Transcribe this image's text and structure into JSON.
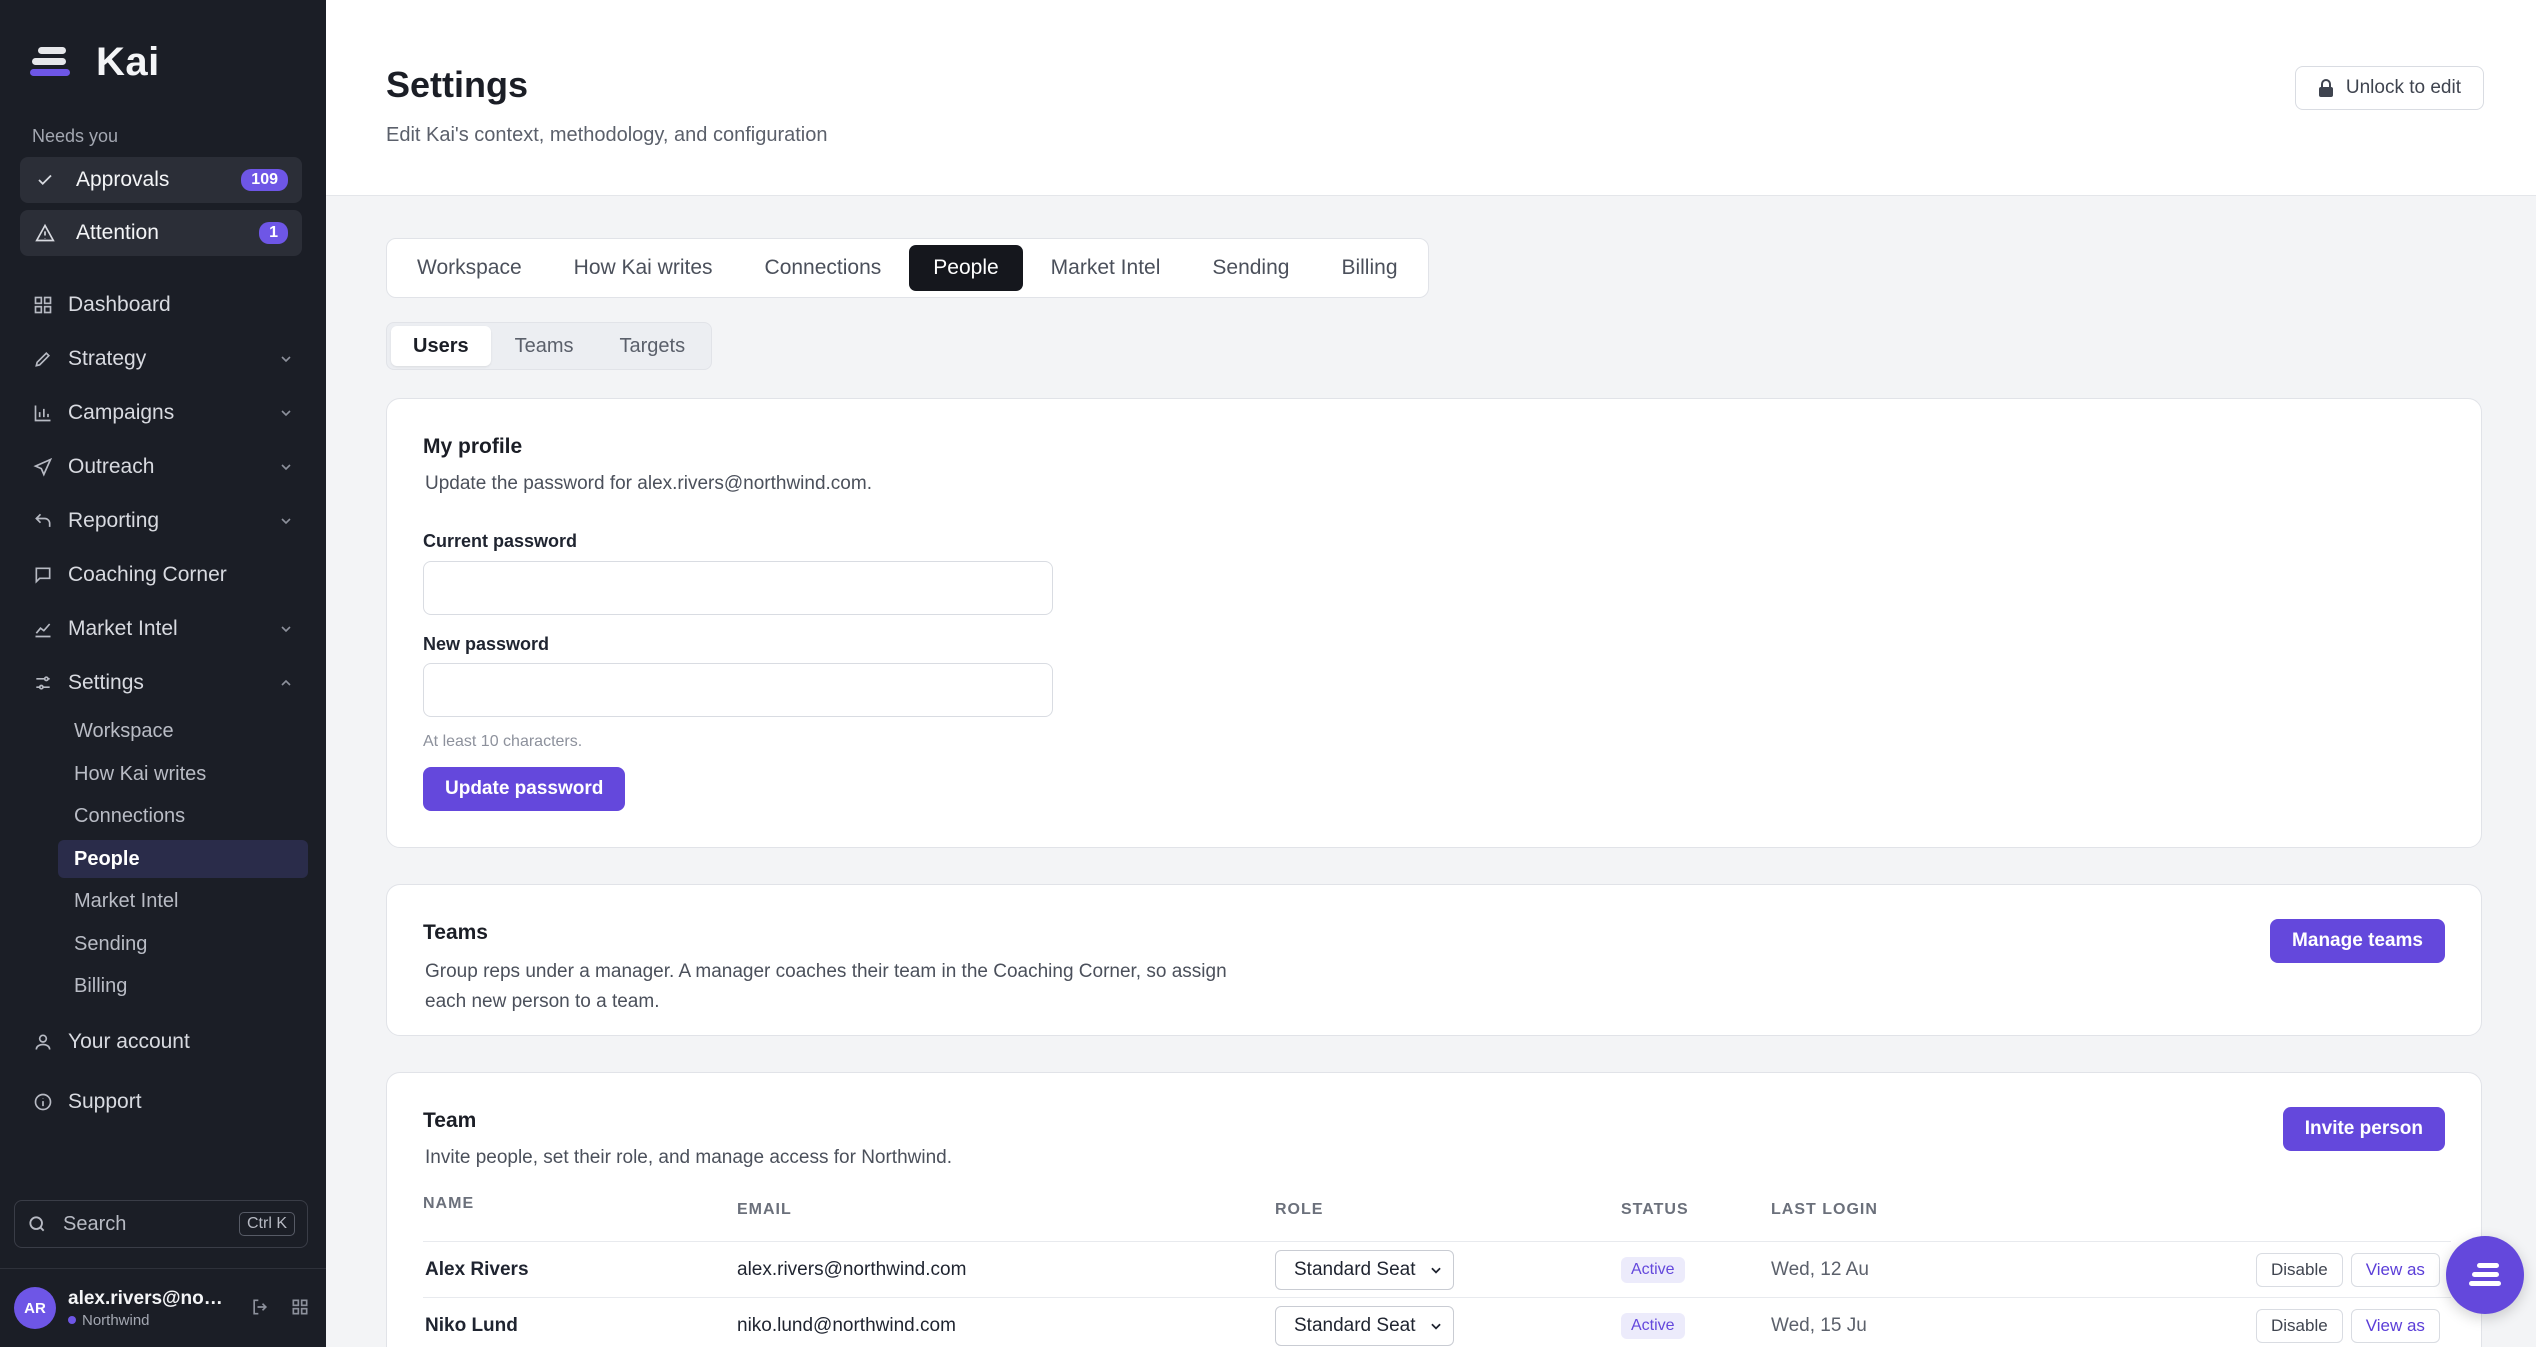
{
  "app": {
    "name": "Kai"
  },
  "sidebar": {
    "needs_label": "Needs you",
    "approvals": {
      "label": "Approvals",
      "count": "109"
    },
    "attention": {
      "label": "Attention",
      "count": "1"
    },
    "nav": {
      "dashboard": "Dashboard",
      "strategy": "Strategy",
      "campaigns": "Campaigns",
      "outreach": "Outreach",
      "reporting": "Reporting",
      "coaching": "Coaching Corner",
      "market_intel": "Market Intel",
      "settings": "Settings",
      "account": "Your account",
      "support": "Support"
    },
    "settings_sub": [
      "Workspace",
      "How Kai writes",
      "Connections",
      "People",
      "Market Intel",
      "Sending",
      "Billing"
    ],
    "search": {
      "label": "Search",
      "shortcut": "Ctrl K"
    },
    "user": {
      "initials": "AR",
      "email": "alex.rivers@northwind.com",
      "org": "Northwind"
    }
  },
  "header": {
    "title": "Settings",
    "subtitle": "Edit Kai's context, methodology, and configuration",
    "unlock_label": "Unlock to edit"
  },
  "tabs": [
    "Workspace",
    "How Kai writes",
    "Connections",
    "People",
    "Market Intel",
    "Sending",
    "Billing"
  ],
  "subtabs": [
    "Users",
    "Teams",
    "Targets"
  ],
  "profile": {
    "title": "My profile",
    "desc": "Update the password for alex.rivers@northwind.com.",
    "current_label": "Current password",
    "new_label": "New password",
    "hint": "At least 10 characters.",
    "button": "Update password"
  },
  "teams": {
    "title": "Teams",
    "desc_line1": "Group reps under a manager. A manager coaches their team in the Coaching Corner, so assign",
    "desc_line2": "each new person to a team.",
    "button": "Manage teams"
  },
  "team": {
    "title": "Team",
    "desc": "Invite people, set their role, and manage access for Northwind.",
    "button": "Invite person",
    "headers": {
      "name": "NAME",
      "email": "EMAIL",
      "role": "ROLE",
      "status": "STATUS",
      "last_login": "LAST LOGIN"
    },
    "rows": [
      {
        "name": "Alex Rivers",
        "email": "alex.rivers@northwind.com",
        "role": "Standard Seat",
        "status": "Active",
        "last_login": "Wed, 12 Au",
        "disable": "Disable",
        "view_as": "View as"
      },
      {
        "name": "Niko Lund",
        "email": "niko.lund@northwind.com",
        "role": "Standard Seat",
        "status": "Active",
        "last_login": "Wed, 15 Ju",
        "disable": "Disable",
        "view_as": "View as"
      }
    ]
  },
  "colors": {
    "accent": "#6448dc",
    "sidebar_bg": "#1b1e26",
    "active_tab": "#15171d"
  }
}
